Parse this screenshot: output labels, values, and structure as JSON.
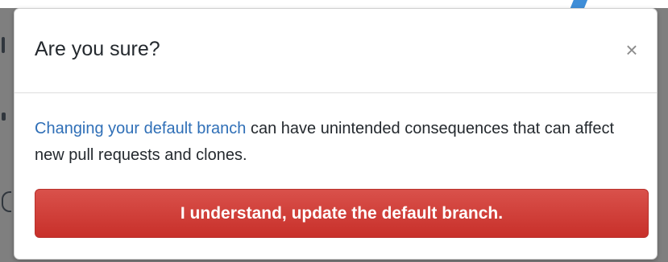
{
  "dialog": {
    "title": "Are you sure?",
    "close_glyph": "×",
    "close_icon": "close-icon",
    "body": {
      "link_text": "Changing your default branch",
      "rest_text": " can have unintended consequences that can affect new pull requests and clones."
    },
    "confirm_label": "I understand, update the default branch."
  },
  "colors": {
    "danger": "#cb2431",
    "link": "#2f6fb7"
  }
}
